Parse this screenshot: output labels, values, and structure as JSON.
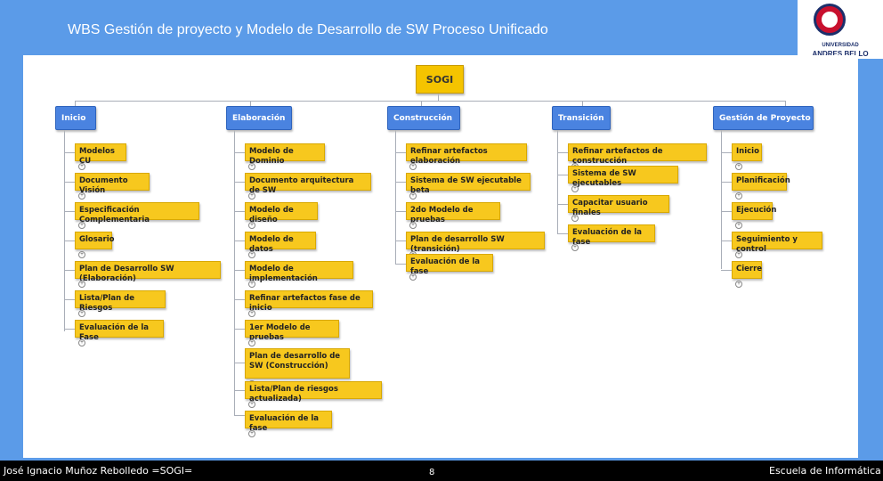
{
  "header": {
    "title": "WBS Gestión de proyecto y Modelo de Desarrollo de SW Proceso Unificado"
  },
  "logo": {
    "line1": "UNIVERSIDAD",
    "line2": "ANDRES BELLO"
  },
  "wbs": {
    "root": "SOGI",
    "phases": [
      {
        "label": "Inicio",
        "items": [
          "Modelos CU",
          "Documento Visión",
          "Especificación Complementaria",
          "Glosario",
          "Plan de Desarrollo SW (Elaboración)",
          "Lista/Plan de Riesgos",
          "Evaluación de la Fase"
        ]
      },
      {
        "label": "Elaboración",
        "items": [
          "Modelo de Dominio",
          "Documento arquitectura de SW",
          "Modelo de diseño",
          "Modelo de datos",
          "Modelo de implementación",
          "Refinar artefactos fase de inicio",
          "1er Modelo de pruebas",
          "Plan de desarrollo de SW (Construcción)",
          "Lista/Plan de riesgos actualizada)",
          "Evaluación de la fase"
        ]
      },
      {
        "label": "Construcción",
        "items": [
          "Refinar artefactos elaboración",
          "Sistema de SW ejecutable beta",
          "2do Modelo de pruebas",
          "Plan de desarrollo SW (transición)",
          "Evaluación de la fase"
        ]
      },
      {
        "label": "Transición",
        "items": [
          "Refinar artefactos de construcción",
          "Sistema de SW ejecutables",
          "Capacitar usuario finales",
          "Evaluación de la fase"
        ]
      },
      {
        "label": "Gestión de Proyecto",
        "items": [
          "Inicio",
          "Planificación",
          "Ejecución",
          "Seguimiento y control",
          "Cierre"
        ]
      }
    ]
  },
  "footer": {
    "left": "José Ignacio Muñoz Rebolledo =SOGI=",
    "page": "8",
    "right": "Escuela de Informática"
  }
}
